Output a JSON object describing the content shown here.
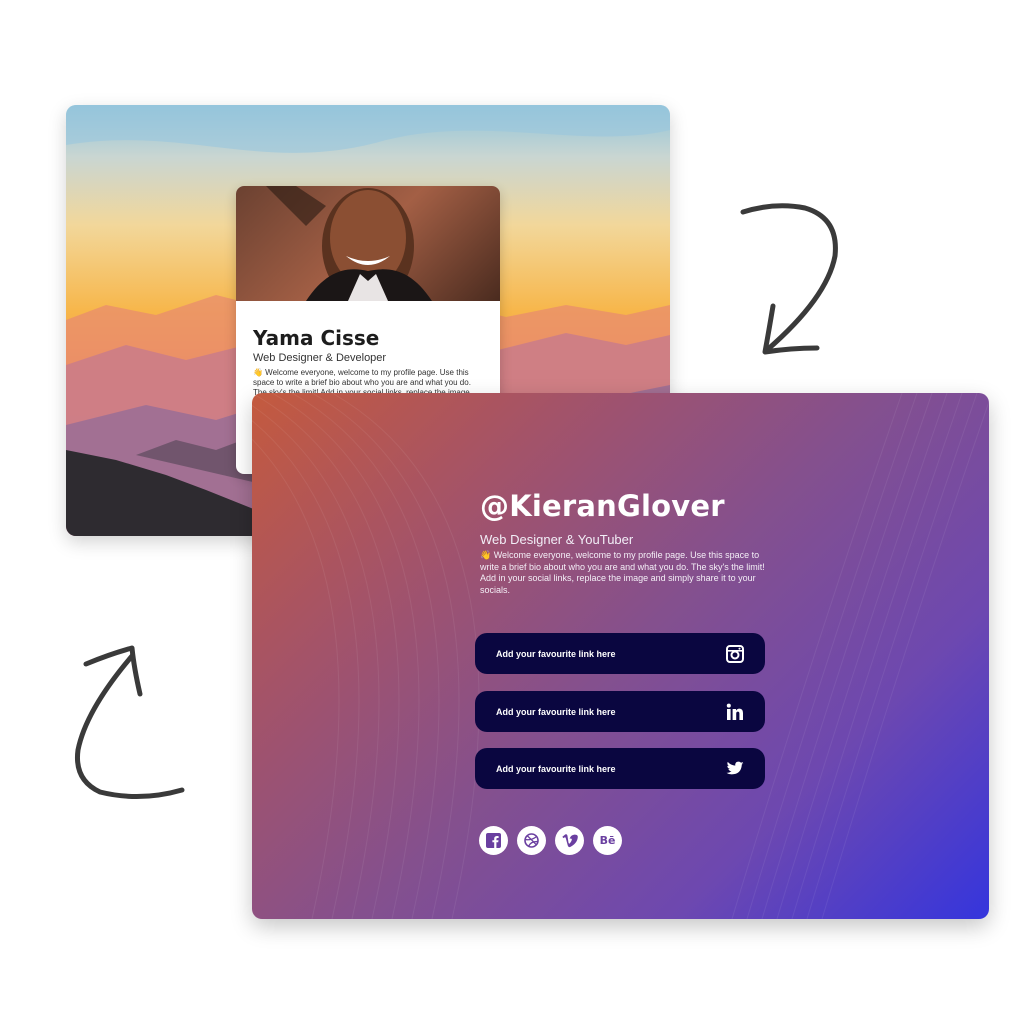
{
  "back_profile": {
    "name": "Yama Cisse",
    "role": "Web Designer & Developer",
    "bio": "👋 Welcome everyone, welcome to my profile page. Use this space to write a brief bio about who you are and what you do. The sky's the limit! Add in your social links, replace the image and simply"
  },
  "front_profile": {
    "handle": "@KieranGlover",
    "role": "Web Designer & YouTuber",
    "bio": "👋 Welcome everyone, welcome to my profile page. Use this space to write a brief bio about who you are and what you do. The sky's the limit! Add in your social links, replace the image and simply share it to your socials."
  },
  "links": [
    {
      "label": "Add your favourite link here",
      "icon": "instagram-icon"
    },
    {
      "label": "Add your favourite link here",
      "icon": "linkedin-icon"
    },
    {
      "label": "Add your favourite link here",
      "icon": "twitter-icon"
    }
  ],
  "social_icons": [
    "facebook-icon",
    "dribbble-icon",
    "vimeo-icon",
    "behance-icon"
  ],
  "colors": {
    "button_bg": "#0a0640",
    "gradient_start": "#c45a3e",
    "gradient_end": "#3535dd",
    "arrow": "#3a3a3a"
  }
}
